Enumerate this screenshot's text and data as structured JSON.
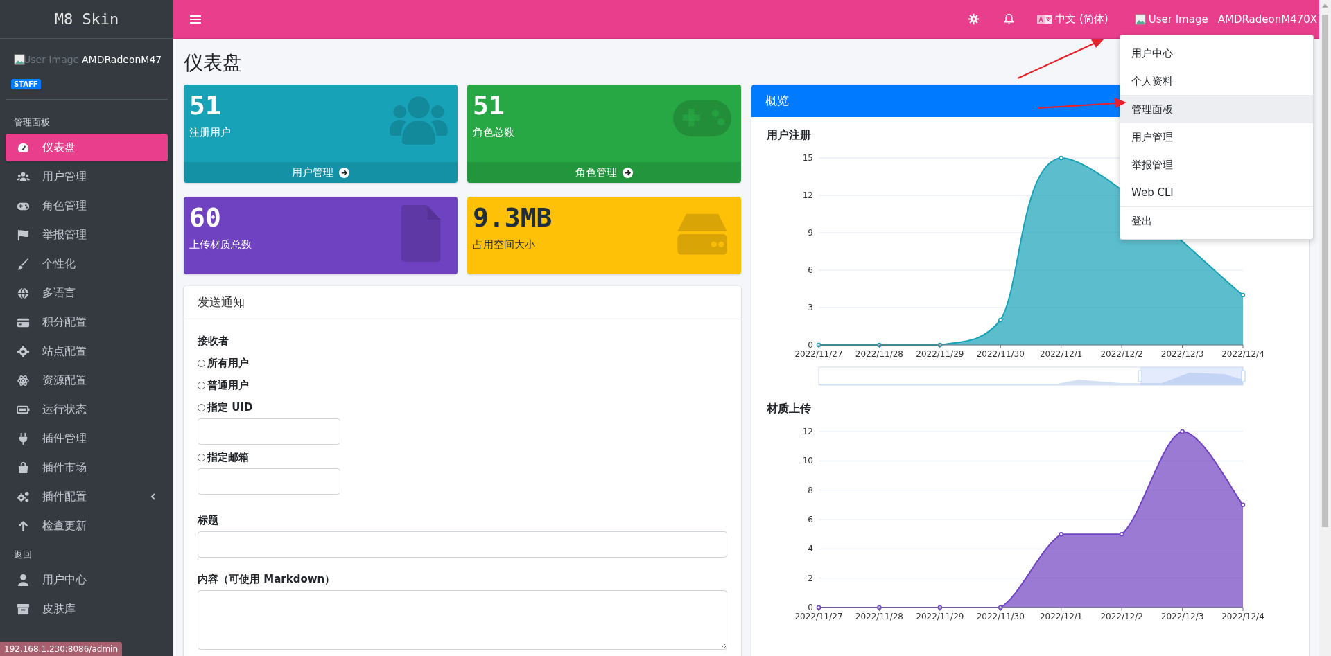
{
  "sidebar": {
    "brand": "M8 Skin",
    "user": {
      "image_alt": "User Image",
      "name": "AMDRadeonM47",
      "badge": "STAFF"
    },
    "sections": [
      {
        "header": "管理面板",
        "items": [
          {
            "label": "仪表盘",
            "selected": true,
            "kind": "link"
          },
          {
            "label": "用户管理",
            "selected": false,
            "kind": "link"
          },
          {
            "label": "角色管理",
            "selected": false,
            "kind": "link"
          },
          {
            "label": "举报管理",
            "selected": false,
            "kind": "link"
          },
          {
            "label": "个性化",
            "selected": false,
            "kind": "link"
          },
          {
            "label": "多语言",
            "selected": false,
            "kind": "link"
          },
          {
            "label": "积分配置",
            "selected": false,
            "kind": "link"
          },
          {
            "label": "站点配置",
            "selected": false,
            "kind": "link"
          },
          {
            "label": "资源配置",
            "selected": false,
            "kind": "link"
          },
          {
            "label": "运行状态",
            "selected": false,
            "kind": "link"
          },
          {
            "label": "插件管理",
            "selected": false,
            "kind": "link"
          },
          {
            "label": "插件市场",
            "selected": false,
            "kind": "link"
          },
          {
            "label": "插件配置",
            "selected": false,
            "kind": "tree",
            "expanded": false
          },
          {
            "label": "检查更新",
            "selected": false,
            "kind": "link"
          }
        ]
      },
      {
        "header": "返回",
        "items": [
          {
            "label": "用户中心",
            "selected": false,
            "kind": "link"
          },
          {
            "label": "皮肤库",
            "selected": false,
            "kind": "link"
          }
        ]
      }
    ]
  },
  "topbar": {
    "language": "中文 (简体)",
    "user": {
      "image_alt": "User Image",
      "name": "AMDRadeonM470X"
    }
  },
  "user_menu": {
    "groups": [
      [
        {
          "label": "用户中心",
          "selected": false
        },
        {
          "label": "个人资料",
          "selected": false
        }
      ],
      [
        {
          "label": "管理面板",
          "selected": true
        },
        {
          "label": "用户管理",
          "selected": false
        },
        {
          "label": "举报管理",
          "selected": false
        },
        {
          "label": "Web CLI",
          "selected": false
        }
      ],
      [
        {
          "label": "登出",
          "selected": false
        }
      ]
    ]
  },
  "page_title": "仪表盘",
  "stat_cards": [
    {
      "value": "51",
      "label": "注册用户",
      "link": "用户管理",
      "color": "#17a2b8"
    },
    {
      "value": "51",
      "label": "角色总数",
      "link": "角色管理",
      "color": "#28a745"
    },
    {
      "value": "60",
      "label": "上传材质总数",
      "color": "#6f42c1"
    },
    {
      "value": "9.3MB",
      "label": "占用空间大小",
      "color": "#ffc107"
    }
  ],
  "notification": {
    "title": "发送通知",
    "recipient_label": "接收者",
    "options": [
      {
        "label": "所有用户",
        "selected": false,
        "kind": "plain"
      },
      {
        "label": "普通用户",
        "selected": false,
        "kind": "plain"
      },
      {
        "label": "指定 UID",
        "selected": false,
        "kind": "input"
      },
      {
        "label": "指定邮箱",
        "selected": false,
        "kind": "input"
      }
    ],
    "title_label": "标题",
    "content_label": "内容（可使用 Markdown）"
  },
  "overview": {
    "title": "概览",
    "charts": [
      {
        "chart_data": {
          "type": "area",
          "title": "用户注册",
          "categories": [
            "2022/11/27",
            "2022/11/28",
            "2022/11/29",
            "2022/11/30",
            "2022/12/1",
            "2022/12/2",
            "2022/12/3",
            "2022/12/4"
          ],
          "series": [
            {
              "color": "#17a2b8",
              "values": [
                0,
                0,
                0,
                2,
                15,
                null,
                null,
                4
              ]
            }
          ],
          "ylim": [
            0,
            15
          ],
          "yticks": [
            0,
            3,
            6,
            9,
            12,
            15
          ],
          "grid": true
        }
      },
      {
        "chart_data": {
          "type": "area",
          "title": "材质上传",
          "categories": [
            "2022/11/27",
            "2022/11/28",
            "2022/11/29",
            "2022/11/30",
            "2022/12/1",
            "2022/12/2",
            "2022/12/3",
            "2022/12/4"
          ],
          "series": [
            {
              "color": "#6f42c1",
              "values": [
                0,
                0,
                0,
                0,
                5,
                5,
                12,
                7
              ]
            }
          ],
          "ylim": [
            0,
            12
          ],
          "yticks": [
            0,
            2,
            4,
            6,
            8,
            10,
            12
          ],
          "grid": true
        }
      }
    ]
  },
  "status_url": "192.168.1.230:8086/admin"
}
